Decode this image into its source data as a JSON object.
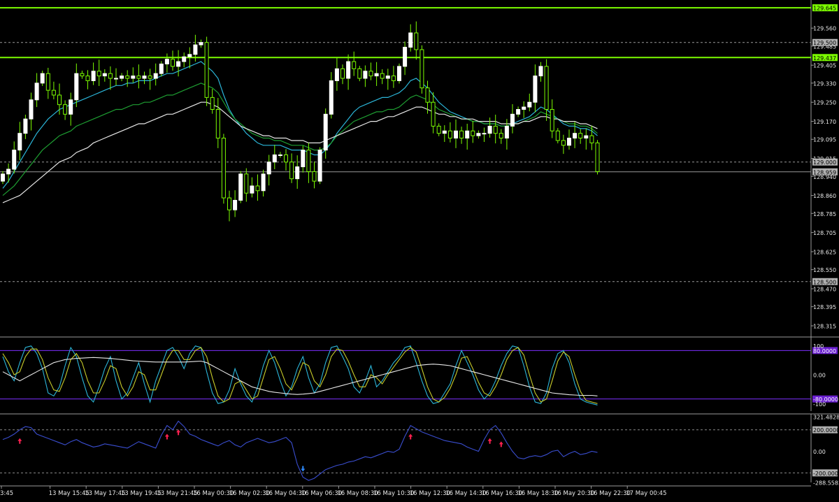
{
  "chart_data": [
    {
      "type": "candlestick",
      "panel": "price",
      "y_ticks": [
        "129.560",
        "129.485",
        "129.405",
        "129.330",
        "129.250",
        "129.170",
        "129.095",
        "129.015",
        "128.940",
        "128.860",
        "128.785",
        "128.705",
        "128.625",
        "128.550",
        "128.470",
        "128.395",
        "128.315"
      ],
      "ylim": [
        128.28,
        129.66
      ],
      "levels": [
        {
          "value": 129.645,
          "label": "129.645",
          "style": "solid",
          "color": "#7cfc00"
        },
        {
          "value": 129.5,
          "label": "129.500",
          "style": "dashed",
          "color": "#9a9a9a"
        },
        {
          "value": 129.437,
          "label": "129.437",
          "style": "solid",
          "color": "#7cfc00"
        },
        {
          "value": 129.0,
          "label": "129.000",
          "style": "dashed",
          "color": "#9a9a9a"
        },
        {
          "value": 128.959,
          "label": "128.959",
          "style": "solid",
          "color": "#9a9a9a"
        },
        {
          "value": 128.5,
          "label": "128.500",
          "style": "dashed",
          "color": "#9a9a9a"
        }
      ],
      "close": [
        128.95,
        128.97,
        129.05,
        129.12,
        129.18,
        129.26,
        129.33,
        129.37,
        129.3,
        129.28,
        129.24,
        129.2,
        129.26,
        129.37,
        129.36,
        129.34,
        129.38,
        129.36,
        129.37,
        129.35,
        129.35,
        129.36,
        129.35,
        129.36,
        129.35,
        129.36,
        129.35,
        129.37,
        129.41,
        129.43,
        129.4,
        129.42,
        129.44,
        129.45,
        129.49,
        129.5,
        129.27,
        129.22,
        129.1,
        128.85,
        128.8,
        128.84,
        128.95,
        128.87,
        128.9,
        128.88,
        128.95,
        129.0,
        129.03,
        129.03,
        129.0,
        128.93,
        128.98,
        129.05,
        128.96,
        128.92,
        129.05,
        129.2,
        129.34,
        129.39,
        129.35,
        129.42,
        129.39,
        129.35,
        129.38,
        129.36,
        129.37,
        129.35,
        129.36,
        129.34,
        129.4,
        129.48,
        129.54,
        129.47,
        129.31,
        129.25,
        129.15,
        129.12,
        129.13,
        129.1,
        129.13,
        129.1,
        129.13,
        129.11,
        129.12,
        129.12,
        129.15,
        129.12,
        129.1,
        129.15,
        129.2,
        129.22,
        129.23,
        129.25,
        129.36,
        129.4,
        129.22,
        129.13,
        129.09,
        129.07,
        129.1,
        129.12,
        129.1,
        129.11,
        129.08,
        128.96
      ],
      "ma": [
        {
          "name": "MA fast",
          "color": "#2bb5d8",
          "values": [
            128.89,
            128.92,
            128.96,
            129.0,
            129.04,
            129.08,
            129.12,
            129.15,
            129.18,
            129.2,
            129.22,
            129.23,
            129.24,
            129.25,
            129.26,
            129.27,
            129.28,
            129.29,
            129.3,
            129.31,
            129.32,
            129.32,
            129.33,
            129.33,
            129.34,
            129.34,
            129.34,
            129.35,
            129.36,
            129.37,
            129.37,
            129.38,
            129.39,
            129.4,
            129.41,
            129.42,
            129.4,
            129.38,
            129.35,
            129.28,
            129.22,
            129.18,
            129.15,
            129.12,
            129.1,
            129.08,
            129.07,
            129.07,
            129.07,
            129.07,
            129.06,
            129.05,
            129.05,
            129.05,
            129.04,
            129.03,
            129.03,
            129.05,
            129.08,
            129.12,
            129.15,
            129.18,
            129.21,
            129.23,
            129.24,
            129.25,
            129.26,
            129.27,
            129.27,
            129.28,
            129.29,
            129.31,
            129.34,
            129.35,
            129.33,
            129.31,
            129.28,
            129.25,
            129.23,
            129.21,
            129.2,
            129.19,
            129.18,
            129.17,
            129.17,
            129.16,
            129.16,
            129.16,
            129.15,
            129.15,
            129.16,
            129.17,
            129.18,
            129.19,
            129.21,
            129.23,
            129.22,
            129.2,
            129.18,
            129.16,
            129.15,
            129.15,
            129.14,
            129.14,
            129.13,
            129.11
          ]
        },
        {
          "name": "MA mid",
          "color": "#1e9e32",
          "values": [
            128.86,
            128.88,
            128.9,
            128.93,
            128.96,
            128.99,
            129.02,
            129.05,
            129.07,
            129.09,
            129.11,
            129.12,
            129.13,
            129.15,
            129.16,
            129.17,
            129.18,
            129.19,
            129.2,
            129.21,
            129.22,
            129.22,
            129.23,
            129.24,
            129.24,
            129.25,
            129.25,
            129.26,
            129.27,
            129.28,
            129.28,
            129.29,
            129.3,
            129.31,
            129.32,
            129.33,
            129.32,
            129.31,
            129.29,
            129.25,
            129.21,
            129.18,
            129.16,
            129.14,
            129.12,
            129.11,
            129.1,
            129.1,
            129.09,
            129.09,
            129.08,
            129.07,
            129.07,
            129.07,
            129.06,
            129.05,
            129.05,
            129.06,
            129.08,
            129.11,
            129.13,
            129.15,
            129.17,
            129.18,
            129.19,
            129.2,
            129.21,
            129.21,
            129.22,
            129.22,
            129.23,
            129.25,
            129.27,
            129.28,
            129.27,
            129.26,
            129.24,
            129.22,
            129.21,
            129.2,
            129.19,
            129.18,
            129.18,
            129.17,
            129.17,
            129.16,
            129.16,
            129.16,
            129.15,
            129.15,
            129.16,
            129.16,
            129.17,
            129.18,
            129.19,
            129.21,
            129.2,
            129.19,
            129.18,
            129.17,
            129.16,
            129.16,
            129.15,
            129.15,
            129.14,
            129.12
          ]
        },
        {
          "name": "MA slow",
          "color": "#e8e8e8",
          "values": [
            128.83,
            128.84,
            128.85,
            128.86,
            128.88,
            128.9,
            128.92,
            128.94,
            128.96,
            128.98,
            129.0,
            129.01,
            129.02,
            129.04,
            129.05,
            129.06,
            129.08,
            129.09,
            129.1,
            129.11,
            129.12,
            129.13,
            129.14,
            129.15,
            129.16,
            129.16,
            129.17,
            129.18,
            129.19,
            129.2,
            129.2,
            129.21,
            129.22,
            129.23,
            129.24,
            129.25,
            129.25,
            129.24,
            129.23,
            129.21,
            129.19,
            129.17,
            129.15,
            129.14,
            129.13,
            129.12,
            129.11,
            129.11,
            129.1,
            129.1,
            129.1,
            129.09,
            129.09,
            129.09,
            129.08,
            129.08,
            129.08,
            129.09,
            129.1,
            129.11,
            129.12,
            129.13,
            129.14,
            129.15,
            129.16,
            129.17,
            129.17,
            129.18,
            129.19,
            129.19,
            129.2,
            129.21,
            129.22,
            129.23,
            129.23,
            129.22,
            129.21,
            129.2,
            129.2,
            129.19,
            129.19,
            129.18,
            129.18,
            129.18,
            129.17,
            129.17,
            129.17,
            129.17,
            129.16,
            129.16,
            129.16,
            129.16,
            129.17,
            129.17,
            129.18,
            129.19,
            129.19,
            129.18,
            129.18,
            129.17,
            129.17,
            129.17,
            129.16,
            129.16,
            129.15,
            129.14
          ]
        }
      ]
    },
    {
      "type": "line",
      "panel": "stochastic",
      "y_ticks": [
        "100",
        "0.00",
        "-100"
      ],
      "ylim": [
        -120,
        120
      ],
      "levels": [
        {
          "value": 80,
          "label": "80.0000"
        },
        {
          "value": -80,
          "label": "-80.0000"
        }
      ],
      "series": [
        {
          "color": "#2bb5d8",
          "values": [
            60,
            10,
            -20,
            40,
            90,
            95,
            70,
            20,
            -60,
            -70,
            -40,
            30,
            90,
            60,
            -10,
            -70,
            -90,
            -40,
            20,
            60,
            -20,
            -80,
            -60,
            -10,
            40,
            -30,
            -90,
            -20,
            30,
            80,
            90,
            60,
            20,
            70,
            95,
            90,
            10,
            -60,
            -95,
            -90,
            -50,
            20,
            -30,
            -70,
            -90,
            -40,
            30,
            80,
            40,
            -20,
            -70,
            -40,
            20,
            60,
            -10,
            -60,
            -30,
            40,
            90,
            95,
            60,
            20,
            -40,
            -60,
            -20,
            30,
            -40,
            -20,
            10,
            40,
            60,
            90,
            95,
            40,
            -20,
            -70,
            -95,
            -90,
            -60,
            -30,
            30,
            80,
            40,
            0,
            -50,
            -80,
            -60,
            -20,
            30,
            70,
            95,
            90,
            30,
            -40,
            -90,
            -95,
            -60,
            20,
            70,
            80,
            40,
            -30,
            -80,
            -90,
            -95,
            -100
          ]
        },
        {
          "color": "#c8cc2a",
          "values": [
            70,
            40,
            0,
            10,
            60,
            85,
            85,
            50,
            -10,
            -50,
            -55,
            -10,
            50,
            70,
            40,
            -20,
            -60,
            -60,
            -20,
            30,
            20,
            -40,
            -70,
            -40,
            10,
            0,
            -50,
            -50,
            0,
            50,
            80,
            80,
            50,
            50,
            80,
            90,
            60,
            -10,
            -70,
            -90,
            -80,
            -30,
            -20,
            -50,
            -80,
            -70,
            -10,
            50,
            60,
            20,
            -30,
            -50,
            -10,
            40,
            30,
            -20,
            -40,
            0,
            60,
            85,
            80,
            45,
            0,
            -40,
            -40,
            0,
            -10,
            -30,
            0,
            25,
            50,
            75,
            90,
            75,
            20,
            -40,
            -80,
            -90,
            -75,
            -45,
            0,
            55,
            60,
            20,
            -25,
            -60,
            -70,
            -40,
            0,
            50,
            80,
            90,
            65,
            0,
            -60,
            -90,
            -80,
            -20,
            45,
            75,
            60,
            0,
            -55,
            -85,
            -90,
            -95
          ]
        },
        {
          "color": "#e8e8e8",
          "values": [
            10,
            0,
            -10,
            -20,
            -10,
            0,
            10,
            20,
            30,
            40,
            45,
            50,
            52,
            54,
            55,
            56,
            57,
            56,
            55,
            54,
            52,
            50,
            48,
            46,
            45,
            44,
            43,
            42,
            42,
            42,
            42,
            42,
            42,
            43,
            44,
            45,
            40,
            30,
            20,
            10,
            0,
            -10,
            -20,
            -30,
            -40,
            -45,
            -50,
            -55,
            -58,
            -60,
            -62,
            -64,
            -65,
            -64,
            -62,
            -60,
            -55,
            -50,
            -45,
            -40,
            -35,
            -30,
            -25,
            -20,
            -15,
            -10,
            -5,
            0,
            5,
            10,
            15,
            20,
            25,
            30,
            32,
            34,
            35,
            34,
            32,
            30,
            25,
            20,
            15,
            10,
            5,
            0,
            -5,
            -10,
            -15,
            -20,
            -25,
            -30,
            -35,
            -40,
            -45,
            -50,
            -55,
            -60,
            -62,
            -64,
            -66,
            -67,
            -68,
            -68,
            -68,
            -70
          ]
        }
      ]
    },
    {
      "type": "line",
      "panel": "cci",
      "y_ticks": [
        "321.4828",
        "200.0000",
        "0.00",
        "-200.0000",
        "-288.5583"
      ],
      "ylim": [
        -288.5583,
        321.4828
      ],
      "levels": [
        {
          "value": 200,
          "label": "200.0000"
        },
        {
          "value": -200,
          "label": "-200.0000"
        }
      ],
      "series": [
        {
          "color": "#3a4ed0",
          "values": [
            110,
            130,
            160,
            200,
            230,
            220,
            160,
            140,
            120,
            100,
            80,
            60,
            90,
            110,
            80,
            60,
            40,
            50,
            70,
            60,
            50,
            40,
            30,
            60,
            90,
            70,
            50,
            30,
            150,
            240,
            200,
            280,
            230,
            160,
            140,
            110,
            90,
            70,
            50,
            80,
            100,
            60,
            40,
            80,
            100,
            120,
            100,
            80,
            90,
            110,
            130,
            80,
            -120,
            -240,
            -270,
            -250,
            -210,
            -170,
            -150,
            -130,
            -120,
            -100,
            -90,
            -70,
            -50,
            -60,
            -40,
            -20,
            0,
            -10,
            20,
            140,
            240,
            210,
            180,
            160,
            140,
            120,
            100,
            90,
            80,
            70,
            40,
            20,
            0,
            110,
            200,
            240,
            170,
            80,
            0,
            -60,
            -70,
            -50,
            -40,
            -50,
            -30,
            0,
            10,
            -50,
            -20,
            0,
            -30,
            -20,
            0,
            -10
          ]
        }
      ],
      "arrows": [
        {
          "index": 3,
          "direction": "up",
          "color": "#ff2050"
        },
        {
          "index": 29,
          "direction": "up",
          "color": "#ff2050"
        },
        {
          "index": 31,
          "direction": "up",
          "color": "#ff2050"
        },
        {
          "index": 53,
          "direction": "down",
          "color": "#2e8bff"
        },
        {
          "index": 72,
          "direction": "up",
          "color": "#ff2050"
        },
        {
          "index": 86,
          "direction": "up",
          "color": "#ff2050"
        },
        {
          "index": 88,
          "direction": "up",
          "color": "#ff2050"
        }
      ]
    }
  ],
  "time_labels": [
    "3:45",
    "13 May 15:45",
    "13 May 17:45",
    "13 May 19:45",
    "13 May 21:45",
    "16 May 00:30",
    "16 May 02:30",
    "16 May 04:30",
    "16 May 06:30",
    "16 May 08:30",
    "16 May 10:30",
    "16 May 12:30",
    "16 May 14:30",
    "16 May 16:30",
    "16 May 18:30",
    "16 May 20:30",
    "16 May 22:30",
    "17 May 00:45"
  ],
  "colors": {
    "background": "#000000",
    "bull": "#ffffff",
    "bear": "#7cfc00",
    "wick": "#7cfc00",
    "axis": "#9a9a9a",
    "level_line": "#7b2fff",
    "level_label_bg": "#6a1fd0"
  }
}
